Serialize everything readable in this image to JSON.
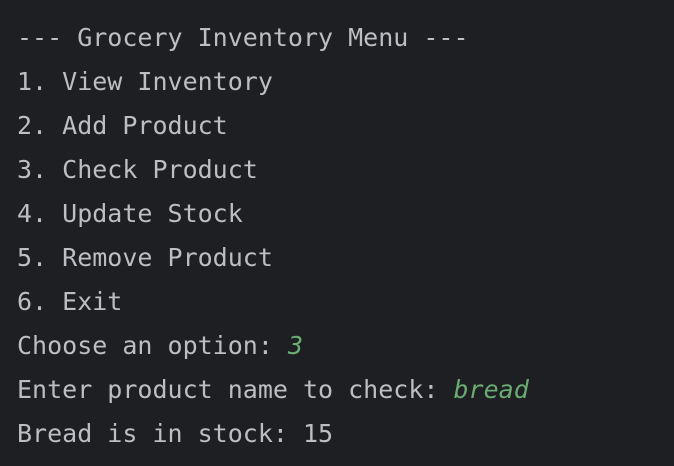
{
  "console": {
    "menu_header": "--- Grocery Inventory Menu ---",
    "menu_items": [
      "1. View Inventory",
      "2. Add Product",
      "3. Check Product",
      "4. Update Stock",
      "5. Remove Product",
      "6. Exit"
    ],
    "option_prompt": "Choose an option: ",
    "option_input": "3",
    "product_prompt": "Enter product name to check: ",
    "product_input": "bread",
    "result": "Bread is in stock: 15"
  },
  "colors": {
    "background": "#1e1f22",
    "text": "#bcbec4",
    "user_input": "#6aab73"
  }
}
